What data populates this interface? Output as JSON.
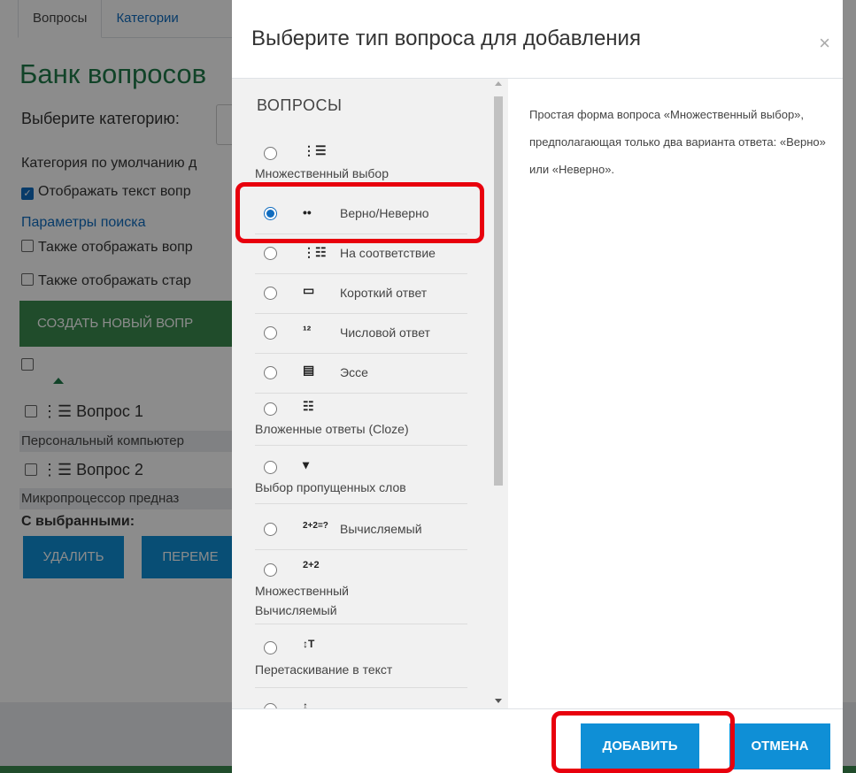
{
  "background": {
    "tabs": [
      {
        "label": "Вопросы"
      },
      {
        "label": "Категории"
      }
    ],
    "title": "Банк вопросов",
    "category_label": "Выберите категорию:",
    "default_category": "Категория по умолчанию д",
    "show_text_checkbox": "Отображать текст вопр",
    "search_params": "Параметры поиска",
    "also_show_1": "Также отображать вопр",
    "also_show_2": "Также отображать стар",
    "create_button": "СОЗДАТЬ НОВЫЙ ВОПР",
    "questions": [
      {
        "title": "Вопрос 1",
        "desc": "Персональный компьютер"
      },
      {
        "title": "Вопрос 2",
        "desc": "Микропроцессор предназ"
      }
    ],
    "with_selected": "С выбранными:",
    "delete_button": "УДАЛИТЬ",
    "move_button": "ПЕРЕМЕ"
  },
  "modal": {
    "title": "Выберите тип вопроса для добавления",
    "close": "×",
    "section": "ВОПРОСЫ",
    "options": [
      {
        "icon": "multichoice-icon",
        "glyph": "⋮☰",
        "label": "Множественный выбор",
        "selected": false
      },
      {
        "icon": "truefalse-icon",
        "glyph": "••",
        "label": "Верно/Неверно",
        "selected": true
      },
      {
        "icon": "match-icon",
        "glyph": "⋮☷",
        "label": "На соответствие",
        "selected": false
      },
      {
        "icon": "shortanswer-icon",
        "glyph": "▭",
        "label": "Короткий ответ",
        "selected": false
      },
      {
        "icon": "numerical-icon",
        "glyph": "¹²",
        "label": "Числовой ответ",
        "selected": false
      },
      {
        "icon": "essay-icon",
        "glyph": "▤",
        "label": "Эссе",
        "selected": false
      },
      {
        "icon": "cloze-icon",
        "glyph": "☷",
        "label": "Вложенные ответы (Cloze)",
        "selected": false
      },
      {
        "icon": "gapselect-icon",
        "glyph": "▾",
        "label": "Выбор пропущенных слов",
        "selected": false
      },
      {
        "icon": "calculated-icon",
        "glyph": "2+2=?",
        "label": "Вычисляемый",
        "selected": false
      },
      {
        "icon": "calcmulti-icon",
        "glyph": "2+2",
        "label": "Множественный Вычисляемый",
        "selected": false
      },
      {
        "icon": "ddwtos-icon",
        "glyph": "↕T",
        "label": "Перетаскивание в текст",
        "selected": false
      },
      {
        "icon": "ddimage-icon",
        "glyph": "↕",
        "label": "",
        "selected": false
      }
    ],
    "description": "Простая форма вопроса «Множественный выбор», предполагающая только два варианта ответа: «Верно» или «Неверно».",
    "add_button": "ДОБАВИТЬ",
    "cancel_button": "ОТМЕНА"
  },
  "colors": {
    "accent": "#0f8fd6",
    "highlight": "#e8000d",
    "green": "#3b8a4f"
  }
}
